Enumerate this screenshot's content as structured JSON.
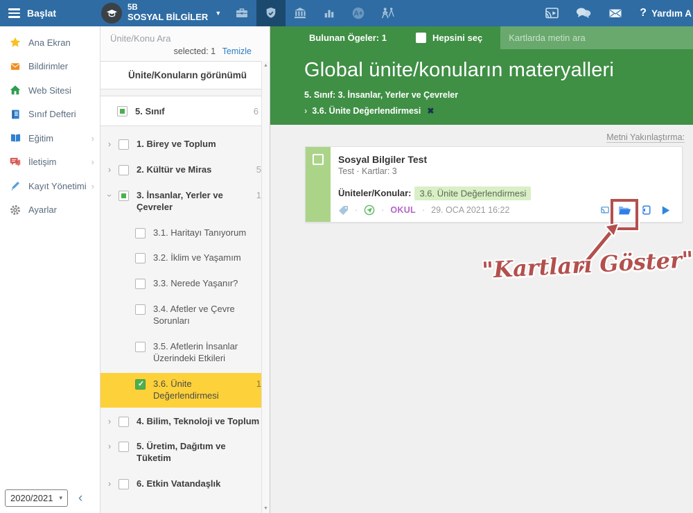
{
  "topbar": {
    "start_label": "Başlat",
    "class_code": "5B",
    "class_name": "SOSYAL BİLGİLER",
    "help_label": "Yardım A"
  },
  "sidebar": {
    "items": [
      {
        "label": "Ana Ekran",
        "icon": "star-icon",
        "color": "#f9c022",
        "arrow": false
      },
      {
        "label": "Bildirimler",
        "icon": "envelope-icon",
        "color": "#f08c1e",
        "arrow": false
      },
      {
        "label": "Web Sitesi",
        "icon": "house-icon",
        "color": "#2e9e4f",
        "arrow": false
      },
      {
        "label": "Sınıf Defteri",
        "icon": "notebook-icon",
        "color": "#2f80d0",
        "arrow": false
      },
      {
        "label": "Eğitim",
        "icon": "book-icon",
        "color": "#2f80d0",
        "arrow": true
      },
      {
        "label": "İletişim",
        "icon": "chat-icon",
        "color": "#d9534f",
        "arrow": true
      },
      {
        "label": "Kayıt Yönetimi",
        "icon": "pencil-icon",
        "color": "#5aa0dc",
        "arrow": true
      },
      {
        "label": "Ayarlar",
        "icon": "gear-icon",
        "color": "#8b8b8b",
        "arrow": false
      }
    ],
    "year_value": "2020/2021"
  },
  "tree": {
    "search_placeholder": "Ünite/Konu Ara",
    "selected_label": "selected: 1",
    "clear_label": "Temizle",
    "view_header": "Ünite/Konuların görünümü",
    "root": {
      "label": "5. Sınıf",
      "count": "6",
      "state": "indeterminate"
    },
    "items": [
      {
        "label": "1. Birey ve Toplum",
        "level": 1,
        "chevron": "right",
        "state": "unchecked",
        "count": ""
      },
      {
        "label": "2. Kültür ve Miras",
        "level": 1,
        "chevron": "right",
        "state": "unchecked",
        "count": "5"
      },
      {
        "label": "3. İnsanlar, Yerler ve Çevreler",
        "level": 1,
        "chevron": "down",
        "state": "indeterminate",
        "count": "1"
      },
      {
        "label": "3.1. Haritayı Tanıyorum",
        "level": 2,
        "chevron": "",
        "state": "unchecked",
        "count": ""
      },
      {
        "label": "3.2. İklim ve Yaşamım",
        "level": 2,
        "chevron": "",
        "state": "unchecked",
        "count": ""
      },
      {
        "label": "3.3. Nerede Yaşanır?",
        "level": 2,
        "chevron": "",
        "state": "unchecked",
        "count": ""
      },
      {
        "label": "3.4. Afetler ve Çevre Sorunları",
        "level": 2,
        "chevron": "",
        "state": "unchecked",
        "count": ""
      },
      {
        "label": "3.5. Afetlerin İnsanlar Üzerindeki Etkileri",
        "level": 2,
        "chevron": "",
        "state": "unchecked",
        "count": ""
      },
      {
        "label": "3.6. Ünite Değerlendirmesi",
        "level": 2,
        "chevron": "",
        "state": "checked",
        "count": "1",
        "highlight": true
      },
      {
        "label": "4. Bilim, Teknoloji ve Toplum",
        "level": 1,
        "chevron": "right",
        "state": "unchecked",
        "count": ""
      },
      {
        "label": "5. Üretim, Dağıtım ve Tüketim",
        "level": 1,
        "chevron": "right",
        "state": "unchecked",
        "count": ""
      },
      {
        "label": "6. Etkin Vatandaşlık",
        "level": 1,
        "chevron": "right",
        "state": "unchecked",
        "count": ""
      }
    ]
  },
  "content": {
    "found_label": "Bulunan Ögeler: 1",
    "select_all_label": "Hepsini seç",
    "search_placeholder": "Kartlarda metin ara",
    "title": "Global ünite/konuların materyalleri",
    "breadcrumb_parent": "5. Sınıf: 3. İnsanlar, Yerler ve Çevreler",
    "breadcrumb_current": "3.6. Ünite Değerlendirmesi",
    "text_zoom_label": "Metni Yakınlaştırma:",
    "card": {
      "title": "Sosyal Bilgiler Test",
      "subtitle": "Test · Kartlar: 3",
      "units_label": "Üniteler/Konular:",
      "unit_chip": "3.6. Ünite Değerlendirmesi",
      "owner": "OKUL",
      "timestamp": "29. OCA 2021 16:22"
    },
    "annotation_text": "\"Kartları Göster\""
  },
  "colors": {
    "topbar_blue": "#2e6ca3",
    "topbar_active": "#1c4a6e",
    "header_green": "#3f8f45",
    "highlight_yellow": "#fdd13a",
    "annotation_red": "#b3504d",
    "accent_blue": "#2f7fe8",
    "check_green": "#4caf50",
    "owner_purple": "#b565c9"
  }
}
